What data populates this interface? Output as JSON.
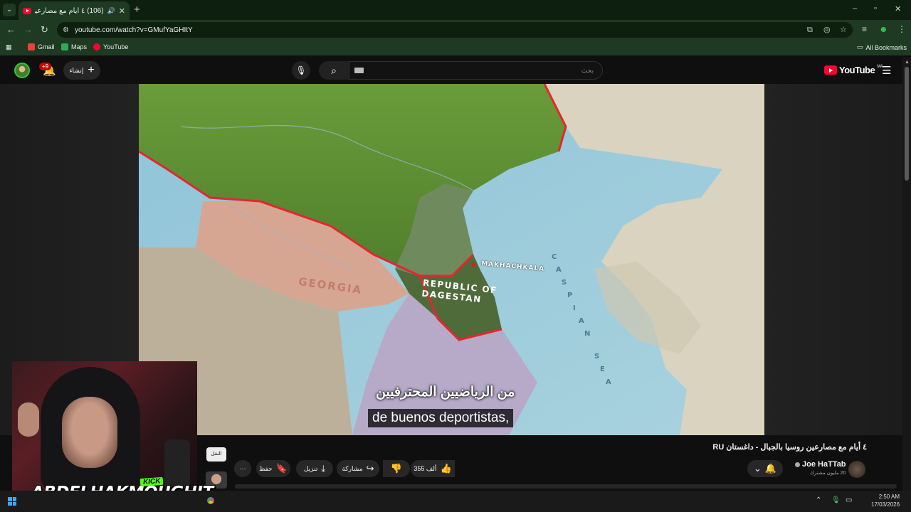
{
  "browser": {
    "tab_title": "(106) ٤ أيام مع مصارعين روسيا بالجبال - داغستان",
    "new_tab": "+",
    "window_controls": [
      "–",
      "▫",
      "✕"
    ],
    "url": "youtube.com/watch?v=GMufYaGHItY",
    "bookmarks": [
      {
        "label": "Gmail",
        "color": "#ea4335"
      },
      {
        "label": "Maps",
        "color": "#34a853"
      },
      {
        "label": "YouTube",
        "color": "#ff0033"
      }
    ],
    "all_bookmarks": "All Bookmarks",
    "accent": "#1e3a22"
  },
  "masthead": {
    "notification_count": "+9",
    "create_label": "إنشاء",
    "search_placeholder": "بحث",
    "logo_text": "YouTube",
    "logo_region": "MA"
  },
  "video": {
    "map_labels": {
      "georgia": "GEORGIA",
      "dagestan_line1": "REPUBLIC OF",
      "dagestan_line2": "DAGESTAN",
      "city": "MAKHACHKALA",
      "sea_letters": [
        "C",
        "A",
        "S",
        "P",
        "I",
        "A",
        "N",
        "S",
        "E",
        "A"
      ]
    },
    "subtitle_arabic": "من الرياضيين المحترفيين",
    "subtitle_spanish": "de buenos deportistas,"
  },
  "details": {
    "title": "٤ أيام مع مصارعين روسيا بالجبال - داغستان RU",
    "channel": "Joe HaTTab",
    "subscribers": "20 مليون مشترك",
    "likes": "355 ألف",
    "share_label": "مشاركة",
    "download_label": "تنزيل",
    "save_label": "حفظ",
    "tooltip": "النقل"
  },
  "overlay": {
    "platform": "KICK",
    "streamer": "ABDELHAKMOUGHIT",
    "platform_color": "#53fc18"
  },
  "taskbar": {
    "time": "2:50 AM",
    "date": "17/03/2026"
  }
}
